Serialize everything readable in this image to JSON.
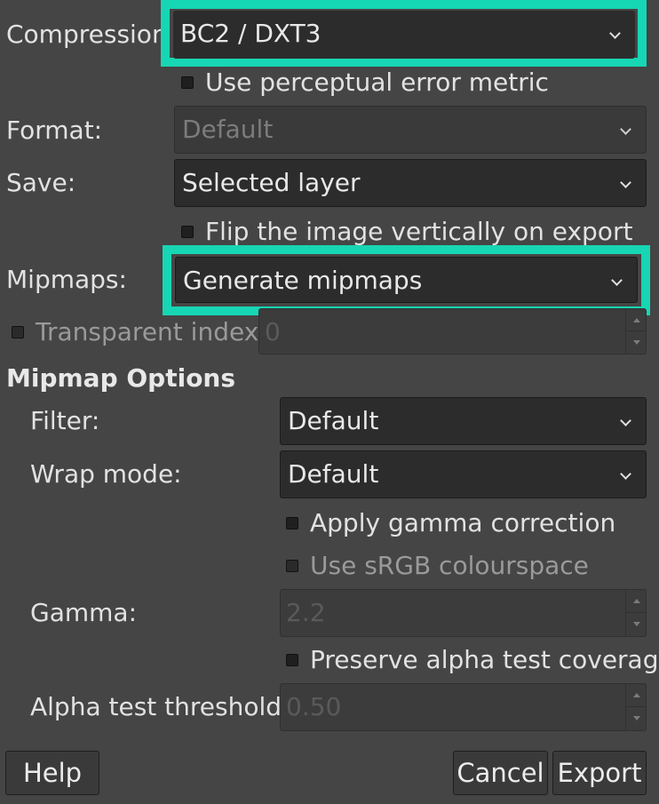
{
  "compression": {
    "label": "Compression",
    "value": "BC2 / DXT3",
    "perceptual_label": "Use perceptual error metric"
  },
  "format": {
    "label": "Format:",
    "value": "Default"
  },
  "save": {
    "label": "Save:",
    "value": "Selected layer",
    "flip_label": "Flip the image vertically on export"
  },
  "mipmaps": {
    "label": "Mipmaps:",
    "value": "Generate mipmaps"
  },
  "transparent_index": {
    "label": "Transparent index:",
    "value": "0"
  },
  "mipmap_options": {
    "title": "Mipmap Options",
    "filter_label": "Filter:",
    "filter_value": "Default",
    "wrap_label": "Wrap mode:",
    "wrap_value": "Default",
    "gamma_correction_label": "Apply gamma correction",
    "srgb_label": "Use sRGB colourspace",
    "gamma_label": "Gamma:",
    "gamma_value": "2.2",
    "preserve_alpha_label": "Preserve alpha test coverage",
    "alpha_threshold_label": "Alpha test threshold:",
    "alpha_threshold_value": "0.50"
  },
  "buttons": {
    "help": "Help",
    "cancel": "Cancel",
    "export": "Export"
  },
  "colors": {
    "background": "#454545",
    "highlight": "#17d6b4",
    "combo_bg": "#2c2c2c"
  }
}
